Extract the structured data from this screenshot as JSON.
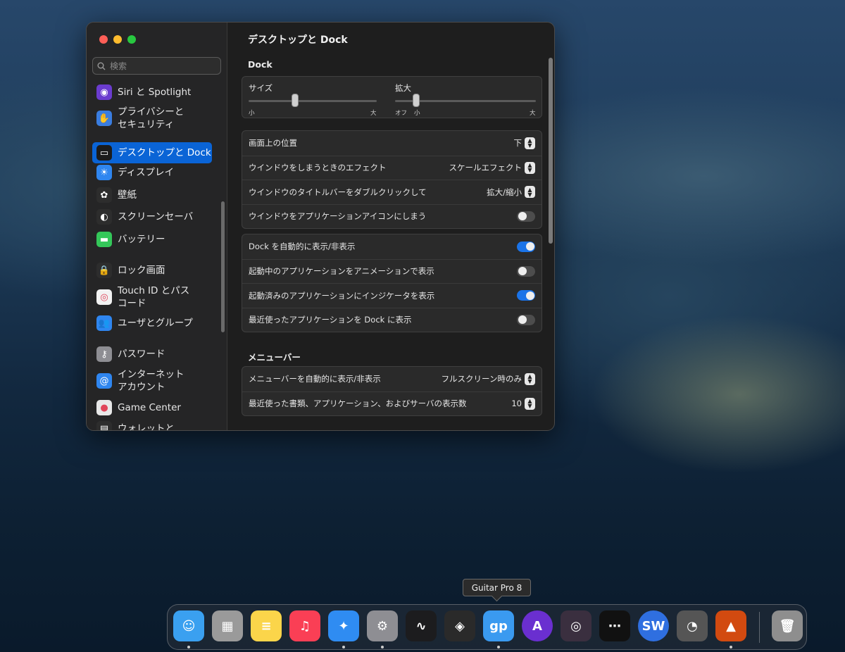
{
  "search": {
    "placeholder": "検索"
  },
  "sidebar": {
    "items": [
      {
        "label": "Siri と Spotlight",
        "icon": "siri-icon",
        "color": "#6b3ccf"
      },
      {
        "label": "プライバシーと\nセキュリティ",
        "icon": "hand-icon",
        "color": "#3a7de0"
      },
      {
        "label": "デスクトップと Dock",
        "icon": "dock-icon",
        "color": "#1c1c1c",
        "active": true
      },
      {
        "label": "ディスプレイ",
        "icon": "sun-icon",
        "color": "#2f86f0"
      },
      {
        "label": "壁紙",
        "icon": "flower-icon",
        "color": "#2d2d2d"
      },
      {
        "label": "スクリーンセーバ",
        "icon": "screensaver-icon",
        "color": "#2d2d2d"
      },
      {
        "label": "バッテリー",
        "icon": "battery-icon",
        "color": "#34c759"
      },
      {
        "label": "ロック画面",
        "icon": "lock-icon",
        "color": "#2d2d2d"
      },
      {
        "label": "Touch ID とパス\nコード",
        "icon": "fingerprint-icon",
        "color": "#f2f2f2"
      },
      {
        "label": "ユーザとグループ",
        "icon": "users-icon",
        "color": "#2f86f0"
      },
      {
        "label": "パスワード",
        "icon": "key-icon",
        "color": "#8e8e93"
      },
      {
        "label": "インターネット\nアカウント",
        "icon": "at-icon",
        "color": "#2f86f0"
      },
      {
        "label": "Game Center",
        "icon": "game-center-icon",
        "color": "#e8e8e8"
      },
      {
        "label": "ウォレットと",
        "icon": "wallet-icon",
        "color": "#2d2d2d"
      }
    ]
  },
  "main": {
    "title": "デスクトップと Dock",
    "dock_section": "Dock",
    "size_label": "サイズ",
    "size_min": "小",
    "size_max": "大",
    "size_level": 0.36,
    "magnify_label": "拡大",
    "magnify_off": "オフ",
    "magnify_min": "小",
    "magnify_max": "大",
    "magnify_level": 0.15,
    "position_label": "画面上の位置",
    "position_value": "下",
    "minimize_effect_label": "ウインドウをしまうときのエフェクト",
    "minimize_effect_value": "スケールエフェクト",
    "doubleclick_label": "ウインドウのタイトルバーをダブルクリックして",
    "doubleclick_value": "拡大/縮小",
    "minimize_to_icon_label": "ウインドウをアプリケーションアイコンにしまう",
    "minimize_to_icon_on": false,
    "autohide_label": "Dock を自動的に表示/非表示",
    "autohide_on": true,
    "animate_label": "起動中のアプリケーションをアニメーションで表示",
    "animate_on": false,
    "indicators_label": "起動済みのアプリケーションにインジケータを表示",
    "indicators_on": true,
    "recents_label": "最近使ったアプリケーションを Dock に表示",
    "recents_on": false,
    "menubar_section": "メニューバー",
    "menubar_autohide_label": "メニューバーを自動的に表示/非表示",
    "menubar_autohide_value": "フルスクリーン時のみ",
    "recent_items_label": "最近使った書類、アプリケーション、およびサーバの表示数",
    "recent_items_value": "10"
  },
  "tooltip": "Guitar Pro 8",
  "dock": {
    "apps": [
      {
        "name": "finder-icon",
        "color": "#3aa0f0",
        "running": true
      },
      {
        "name": "launchpad-icon",
        "color": "#9a9a9a",
        "running": false
      },
      {
        "name": "notes-icon",
        "color": "#fbd54a",
        "running": false
      },
      {
        "name": "music-icon",
        "color": "#fa3f55",
        "running": false
      },
      {
        "name": "safari-icon",
        "color": "#2f8cf2",
        "running": true
      },
      {
        "name": "system-settings-icon",
        "color": "#8e8e93",
        "running": true
      },
      {
        "name": "voice-memo-icon",
        "color": "#1c1c1e",
        "running": false
      },
      {
        "name": "davinci-resolve-icon",
        "color": "#2a2a2a",
        "running": false
      },
      {
        "name": "guitar-pro-icon",
        "color": "#3a9af0",
        "running": true
      },
      {
        "name": "arturia-icon",
        "color": "#6a2fd0",
        "running": false
      },
      {
        "name": "vinyl-icon",
        "color": "#3a2f3f",
        "running": false
      },
      {
        "name": "pads-icon",
        "color": "#111111",
        "running": false
      },
      {
        "name": "sw-icon",
        "color": "#2f6fe0",
        "running": false
      },
      {
        "name": "rme-totalmix-icon",
        "color": "#555555",
        "running": false
      },
      {
        "name": "rme-fire-icon",
        "color": "#d24a10",
        "running": true
      },
      {
        "name": "trash-icon",
        "color": "#8e8e8e",
        "running": false
      }
    ]
  }
}
